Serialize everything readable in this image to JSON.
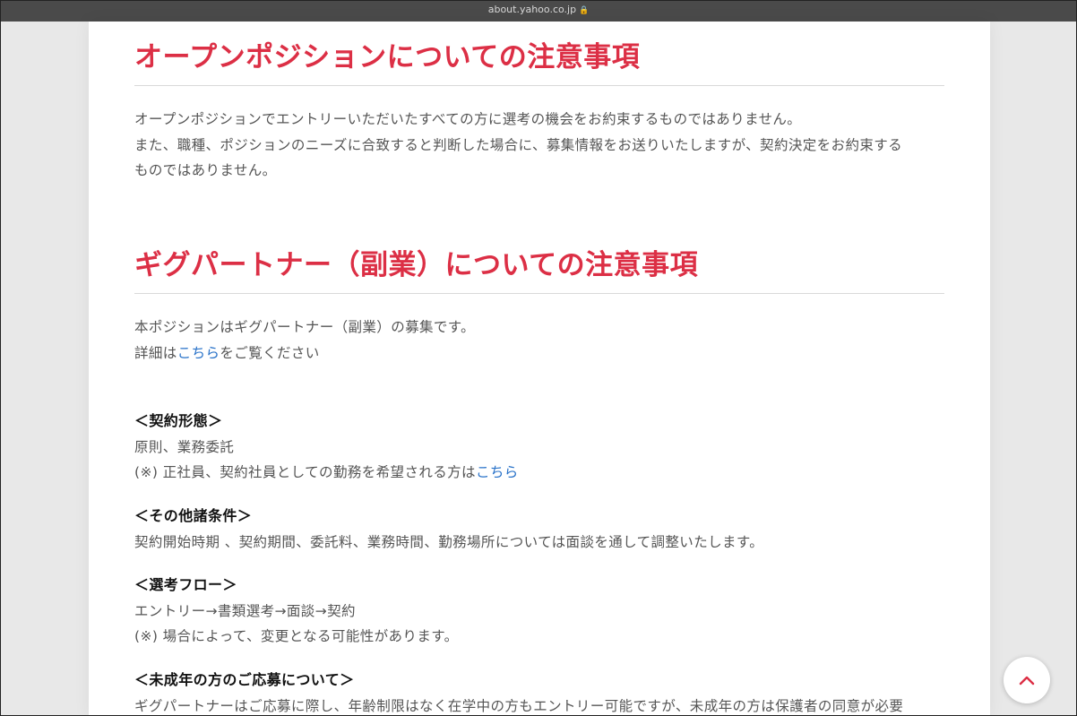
{
  "browser": {
    "url": "about.yahoo.co.jp"
  },
  "section1": {
    "title": "オープンポジションについての注意事項",
    "line1": "オープンポジションでエントリーいただいたすべての方に選考の機会をお約束するものではありません。",
    "line2": "また、職種、ポジションのニーズに合致すると判断した場合に、募集情報をお送りいたしますが、契約決定をお約束する",
    "line3": "ものではありません。"
  },
  "section2": {
    "title": "ギグパートナー（副業）についての注意事項",
    "line1": "本ポジションはギグパートナー（副業）の募集です。",
    "line2_prefix": "詳細は",
    "line2_link": "こちら",
    "line2_suffix": "をご覧ください"
  },
  "contract": {
    "heading": "＜契約形態＞",
    "line1": "原則、業務委託",
    "line2_prefix": "(※) 正社員、契約社員としての勤務を希望される方は",
    "line2_link": "こちら"
  },
  "other": {
    "heading": "＜その他諸条件＞",
    "line1": "契約開始時期 、契約期間、委託料、業務時間、勤務場所については面談を通して調整いたします。"
  },
  "flow": {
    "heading": "＜選考フロー＞",
    "line1": "エントリー→書類選考→面談→契約",
    "line2": "(※) 場合によって、変更となる可能性があります。"
  },
  "minor": {
    "heading": "＜未成年の方のご応募について＞",
    "line1": "ギグパートナーはご応募に際し、年齢制限はなく在学中の方もエントリー可能ですが、未成年の方は保護者の同意が必要"
  },
  "colors": {
    "accent": "#dc2f45",
    "link": "#2a73c9"
  },
  "icons": {
    "lock": "lock-icon",
    "scroll_top": "chevron-up-icon"
  }
}
